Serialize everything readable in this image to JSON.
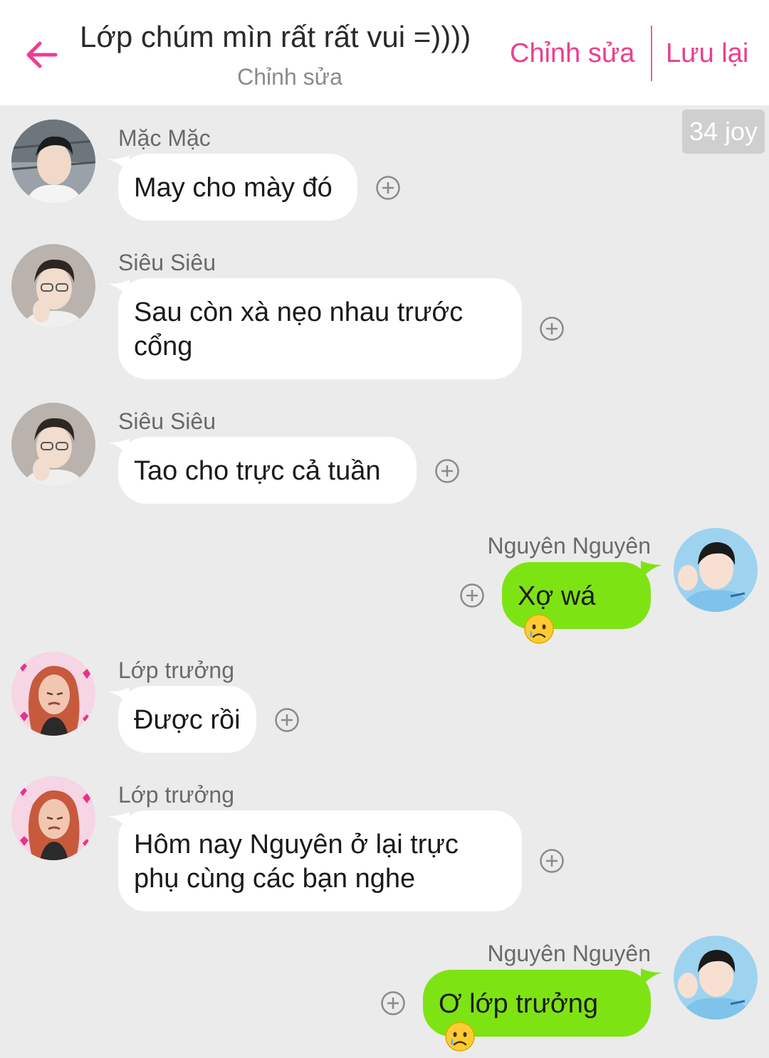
{
  "header": {
    "title": "Lớp chúm mìn rất rất vui =))))",
    "subtitle": "Chỉnh sửa",
    "edit_label": "Chỉnh sửa",
    "save_label": "Lưu lại"
  },
  "badge": "34 joy",
  "messages": [
    {
      "sender": "Mặc Mặc",
      "text": "May cho mày đó"
    },
    {
      "sender": "Siêu Siêu",
      "text": "Sau còn xà nẹo nhau trước cổng"
    },
    {
      "sender": "Siêu Siêu",
      "text": "Tao cho trực cả tuần"
    },
    {
      "sender": "Nguyên Nguyên",
      "text": "Xợ wá"
    },
    {
      "sender": "Lớp trưởng",
      "text": "Được rồi"
    },
    {
      "sender": "Lớp trưởng",
      "text": "Hôm nay Nguyên ở lại trực phụ cùng các bạn nghe"
    },
    {
      "sender": "Nguyên Nguyên",
      "text": "Ơ lớp trưởng"
    }
  ],
  "colors": {
    "accent": "#ec3f8f",
    "outgoing_bubble": "#7ee313",
    "incoming_bubble": "#ffffff",
    "background": "#ebebeb"
  },
  "icons": [
    "back-arrow-icon",
    "add-reaction-icon",
    "crying-face-emoji"
  ]
}
